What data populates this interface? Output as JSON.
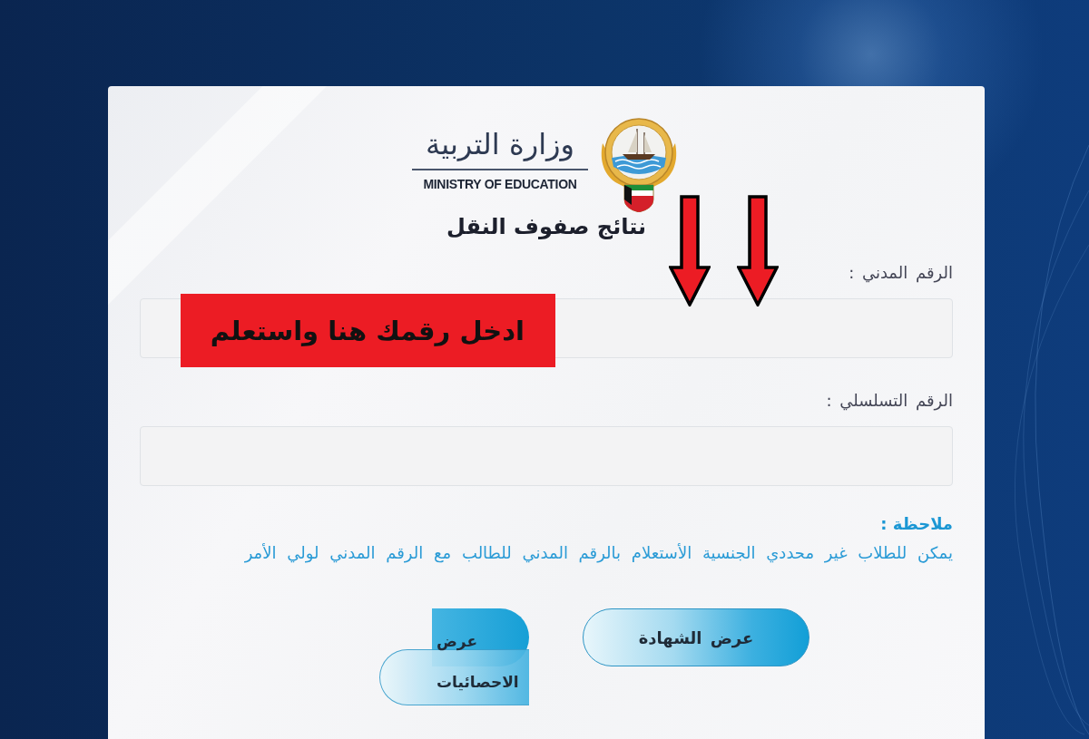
{
  "header": {
    "ministry_name_arabic": "وزارة التربية",
    "ministry_name_english": "MINISTRY OF EDUCATION",
    "title": "نتائج صفوف النقل"
  },
  "fields": [
    {
      "label": "الرقم المدني :"
    },
    {
      "label": "الرقم التسلسلي :"
    }
  ],
  "note": {
    "heading": "ملاحظة :",
    "text": "يمكن للطلاب غير محددي الجنسية الأستعلام بالرقم المدني للطالب مع الرقم المدني لولي الأمر"
  },
  "buttons": [
    {
      "label": "عرض الشهادة",
      "kind": "pill"
    },
    {
      "label": "عرض الاحصائيات",
      "kind": "wrapped"
    }
  ],
  "callout": {
    "text": "ادخل رقمك هنا واستعلم"
  }
}
